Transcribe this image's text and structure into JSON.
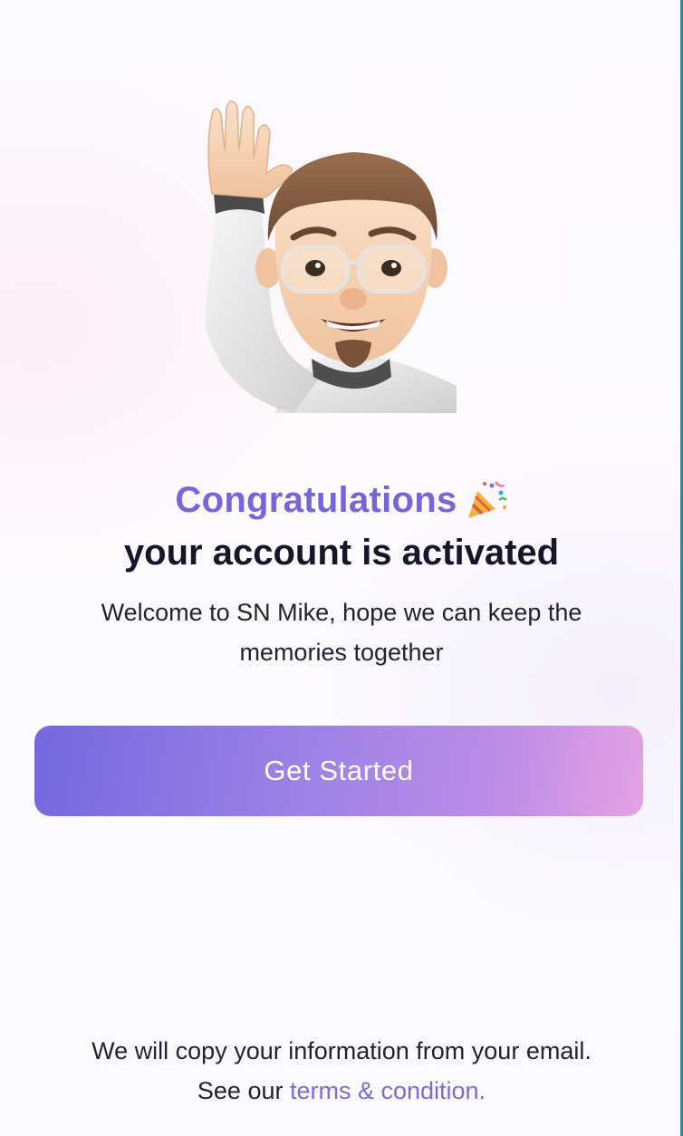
{
  "hero": {
    "avatar_icon": "waving-memoji-avatar"
  },
  "headline": {
    "congrats": "Congratulations",
    "celebration_icon": "party-popper-icon",
    "subtitle": "your account is activated"
  },
  "welcome": {
    "line1": "Welcome to SN Mike, hope we can keep the",
    "line2": "memories together"
  },
  "cta": {
    "label": "Get Started"
  },
  "footer": {
    "line1": "We will copy your information from your email.",
    "see_our": "See our ",
    "terms_label": "terms & condition."
  },
  "colors": {
    "accent": "#7567d8",
    "heading": "#16162b",
    "button_gradient_start": "#7468df",
    "button_gradient_end": "#e6a2e4"
  }
}
